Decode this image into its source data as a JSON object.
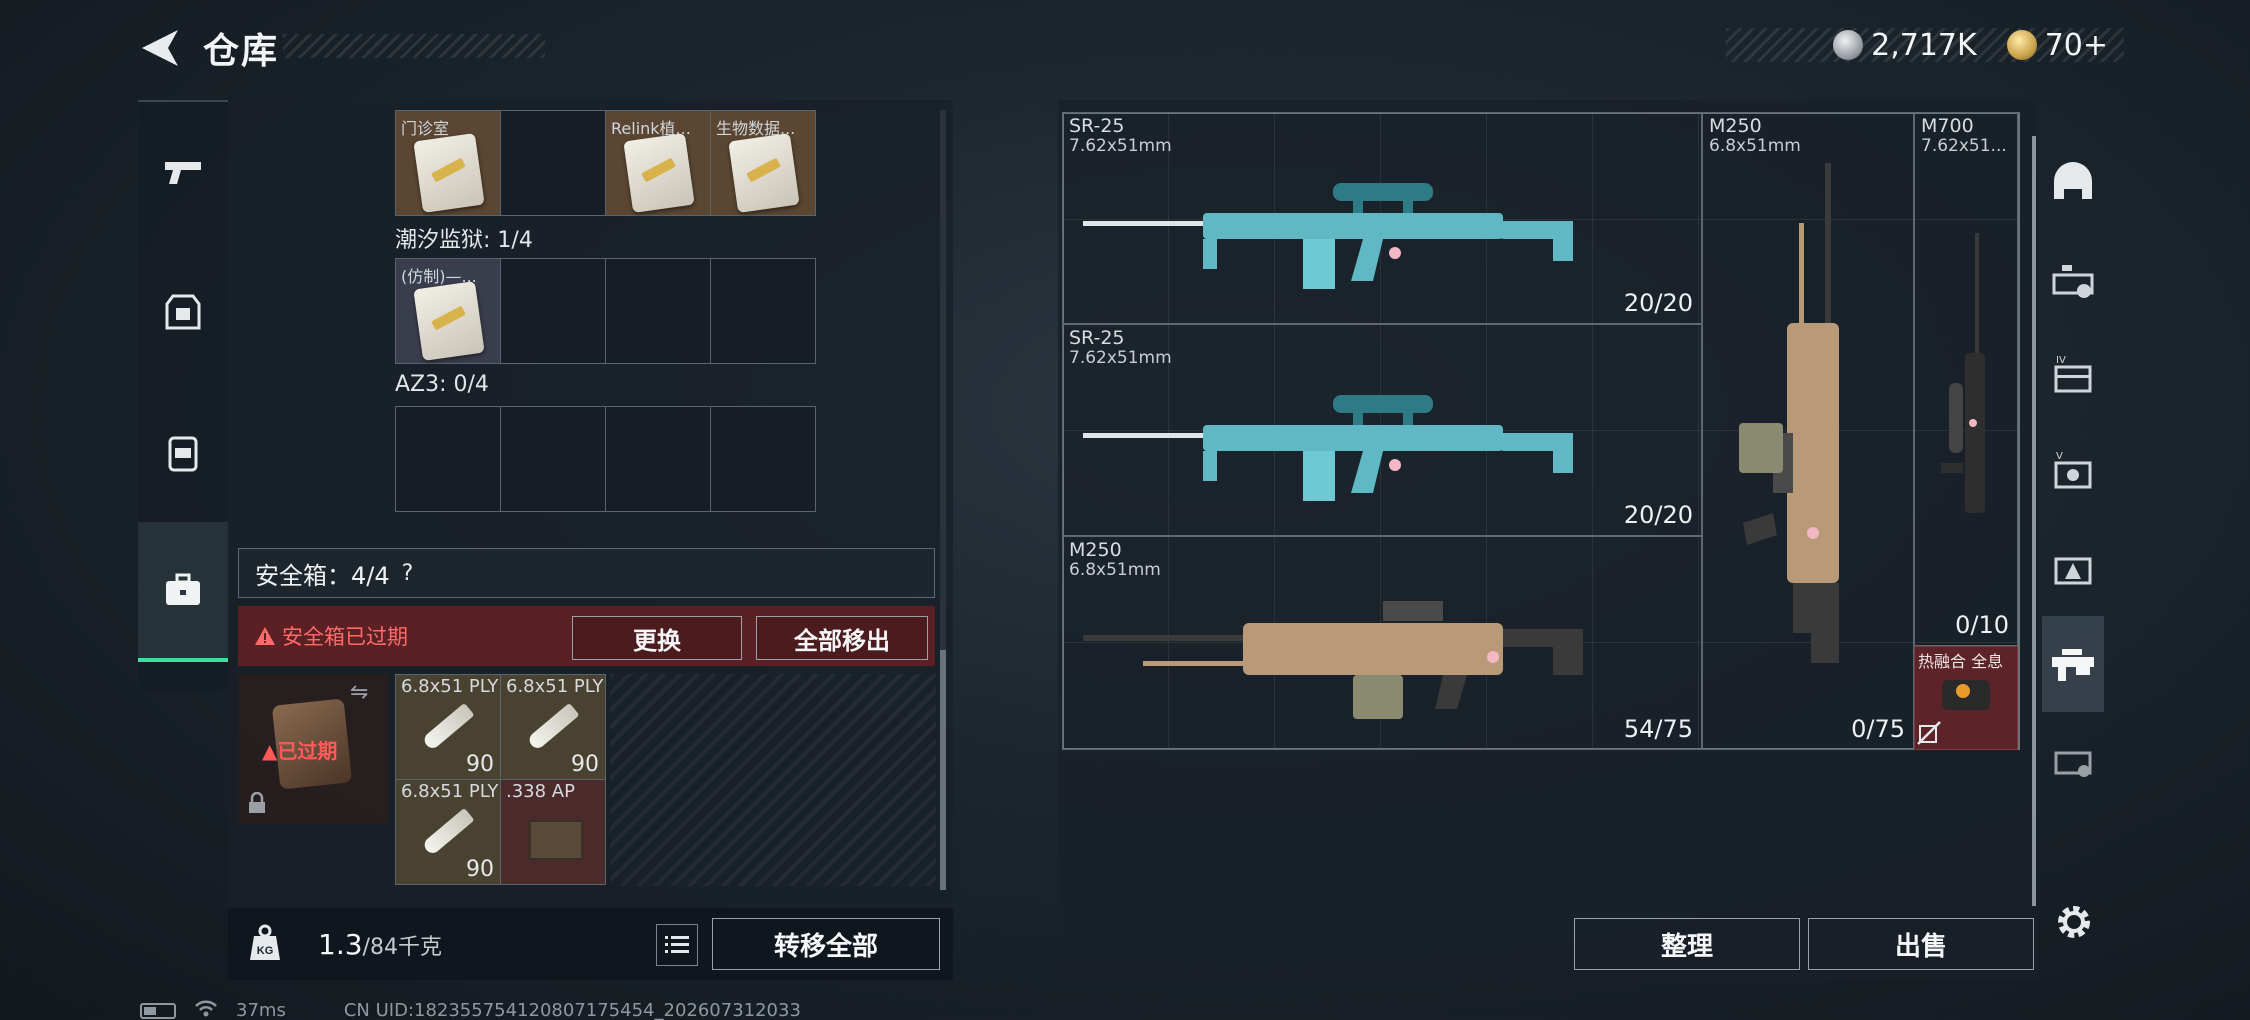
{
  "header": {
    "title": "仓库",
    "currency_1": "2,717K",
    "currency_2": "70+"
  },
  "storage": {
    "row1_slots": [
      "门诊室",
      "",
      "Relink植...",
      "生物数据..."
    ],
    "section_2_label": "潮汐监狱: 1/4",
    "row2_slots": [
      "(仿制)—..."
    ],
    "section_3_label": "AZ3: 0/4"
  },
  "secure_box": {
    "label": "安全箱：4/4",
    "help": "?",
    "expired_warning": "安全箱已过期",
    "replace_label": "更换",
    "remove_all_label": "全部移出",
    "case_status": "已过期",
    "ammo": [
      {
        "name": "6.8x51 PLY",
        "count": "90"
      },
      {
        "name": "6.8x51 PLY",
        "count": "90"
      },
      {
        "name": "6.8x51 PLY",
        "count": "90"
      },
      {
        "name": ".338 AP",
        "count": ""
      }
    ]
  },
  "weight": {
    "current": "1.3",
    "max": "/84千克",
    "icon_label": "KG",
    "transfer_all_label": "转移全部"
  },
  "weapons": [
    {
      "name": "SR-25",
      "caliber": "7.62x51mm",
      "ammo": "20/20",
      "color": "#5fb8c4"
    },
    {
      "name": "SR-25",
      "caliber": "7.62x51mm",
      "ammo": "20/20",
      "color": "#5fb8c4"
    },
    {
      "name": "M250",
      "caliber": "6.8x51mm",
      "ammo": "54/75",
      "color": "#b89a78"
    },
    {
      "name": "M250",
      "caliber": "6.8x51mm",
      "ammo": "0/75",
      "color": "#b89a78"
    },
    {
      "name": "M700",
      "caliber": "7.62x51...",
      "ammo": "0/10",
      "color": "#3a3a3a"
    }
  ],
  "thermal": {
    "label": "热融合 全息"
  },
  "actions": {
    "tidy_label": "整理",
    "sell_label": "出售"
  },
  "footer": {
    "ping": "37ms",
    "uid": "CN UID:182355754120807175454_202607312033"
  },
  "colors": {
    "accent_green": "#3ee0a0",
    "warning_red": "#ff6a6a",
    "expired_bg": "#5a2024"
  },
  "icons": {
    "back": "back-arrow-icon",
    "rail": [
      "pistol-icon",
      "armor-icon",
      "backpack-icon",
      "briefcase-icon"
    ],
    "filters": [
      "helmet-icon",
      "tier3-weapon-icon",
      "tier4-case-icon",
      "tier5-item-icon",
      "tier3-warning-icon",
      "rifle-icon",
      "tier3-misc-icon",
      "settings-icon"
    ]
  }
}
